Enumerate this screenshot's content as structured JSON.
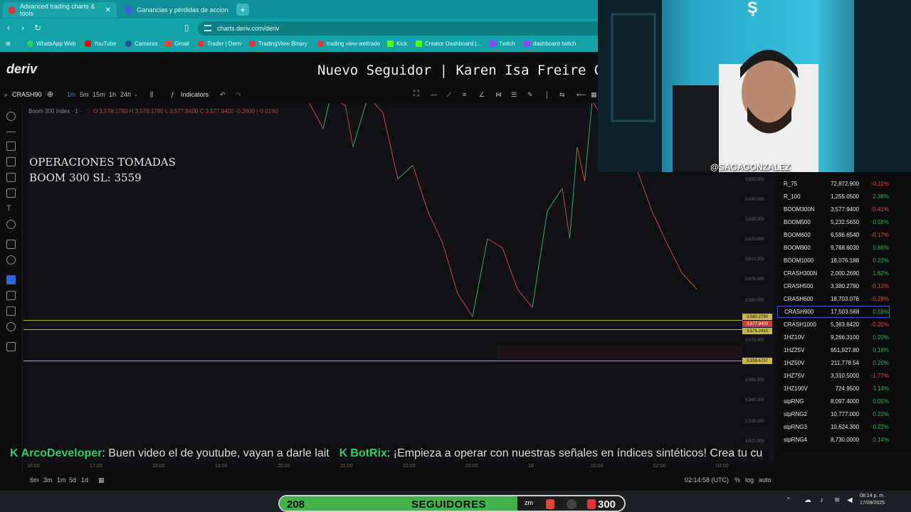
{
  "browser": {
    "tabs": [
      {
        "label": "Advanced trading charts & tools",
        "active": true
      },
      {
        "label": "Ganancias y pérdidas de acciones | Wi",
        "active": false
      }
    ],
    "url": "charts.deriv.com/deriv",
    "bookmarks": [
      "WhatsApp Web",
      "YouTube",
      "Camaras",
      "Gmail",
      "Trader | Deriv",
      "TradingView Binary",
      "trading view weltrade",
      "Kick",
      "Creator Dashboard |...",
      "Twitch",
      "dashboard twitch"
    ]
  },
  "app": {
    "logo": "deriv",
    "symbol": "CRASH90",
    "timeframes": [
      "1m",
      "5m",
      "15m",
      "1h",
      "24h"
    ],
    "indicators_label": "Indicators",
    "chart_title": "Boom 300 Index · 1 ·",
    "ohlc": "O 3,578.1780  H 3,578.1780  L 3,577.9400  C 3,577.9400  -0.2800 (-0.01%)"
  },
  "overlay": {
    "follower_banner": "Nuevo Seguidor | Karen Isa Freire Galindo",
    "ops_line1": "OPERACIONES TOMADAS",
    "ops_line2": "BOOM 300 SL: 3559",
    "handle": "@SAGAGONZALEZ"
  },
  "chart_data": {
    "type": "line",
    "title": "Boom 300 Index",
    "y_ticks": [
      "3,650,000",
      "3,640,000",
      "3,630,000",
      "3,620,000",
      "3,610,000",
      "3,600,000",
      "3,590,000",
      "3,570,000",
      "3,550,000",
      "3,540,000",
      "3,530,000",
      "3,520,000"
    ],
    "x_ticks": [
      "16:00",
      "17:00",
      "18:00",
      "19:00",
      "20:00",
      "21:00",
      "22:00",
      "23:00",
      "18",
      "01:00",
      "02:00",
      "03:00"
    ],
    "price_labels": [
      "3,580.2790",
      "3,577.9400",
      "3,575.2410",
      "3,559.6737"
    ],
    "y_range": [
      3518,
      3656
    ],
    "series": [
      {
        "points": [
          [
            0,
            3660
          ],
          [
            2,
            3648
          ],
          [
            3,
            3662
          ],
          [
            5,
            3658
          ],
          [
            6,
            3640
          ],
          [
            8,
            3662
          ],
          [
            10,
            3655
          ],
          [
            12,
            3626
          ],
          [
            14,
            3632
          ],
          [
            16,
            3612
          ],
          [
            18,
            3598
          ],
          [
            20,
            3576
          ],
          [
            22,
            3566
          ],
          [
            24,
            3600
          ],
          [
            26,
            3596
          ],
          [
            28,
            3578
          ],
          [
            30,
            3570
          ],
          [
            32,
            3612
          ],
          [
            34,
            3622
          ],
          [
            35,
            3600
          ],
          [
            36,
            3640
          ],
          [
            37,
            3625
          ],
          [
            38,
            3660
          ],
          [
            40,
            3650
          ],
          [
            42,
            3640
          ],
          [
            44,
            3630
          ],
          [
            46,
            3612
          ],
          [
            48,
            3598
          ],
          [
            50,
            3585
          ],
          [
            52,
            3578
          ]
        ]
      }
    ],
    "h_lines": [
      3580.279,
      3575.241,
      3559.6737
    ],
    "current_price": 3577.94
  },
  "market_list": [
    {
      "sym": "R_75",
      "price": "72,872.900",
      "change": "-0.11%",
      "dir": "down"
    },
    {
      "sym": "R_100",
      "price": "1,255.0500",
      "change": "2.38%",
      "dir": "up"
    },
    {
      "sym": "BOOM300N",
      "price": "3,577.9400",
      "change": "-0.41%",
      "dir": "down"
    },
    {
      "sym": "BOOM500",
      "price": "5,232.5650",
      "change": "0.58%",
      "dir": "up"
    },
    {
      "sym": "BOOM600",
      "price": "6,596.6540",
      "change": "-0.17%",
      "dir": "down"
    },
    {
      "sym": "BOOM900",
      "price": "9,768.6030",
      "change": "0.86%",
      "dir": "up"
    },
    {
      "sym": "BOOM1000",
      "price": "18,076.188",
      "change": "0.22%",
      "dir": "up"
    },
    {
      "sym": "CRASH300N",
      "price": "2,000.2690",
      "change": "1.62%",
      "dir": "up"
    },
    {
      "sym": "CRASH500",
      "price": "3,380.2780",
      "change": "-0.12%",
      "dir": "down"
    },
    {
      "sym": "CRASH600",
      "price": "18,703.076",
      "change": "-0.28%",
      "dir": "down"
    },
    {
      "sym": "CRASH900",
      "price": "17,503.568",
      "change": "0.59%",
      "dir": "up"
    },
    {
      "sym": "CRASH1000",
      "price": "5,363.6420",
      "change": "-0.20%",
      "dir": "down"
    },
    {
      "sym": "1HZ10V",
      "price": "9,266.3100",
      "change": "0.20%",
      "dir": "up"
    },
    {
      "sym": "1HZ25V",
      "price": "651,927.80",
      "change": "0.18%",
      "dir": "up"
    },
    {
      "sym": "1HZ50V",
      "price": "211,778.54",
      "change": "0.20%",
      "dir": "up"
    },
    {
      "sym": "1HZ75V",
      "price": "3,310.5000",
      "change": "-1.77%",
      "dir": "down"
    },
    {
      "sym": "1HZ100V",
      "price": "724.9500",
      "change": "3.14%",
      "dir": "up"
    },
    {
      "sym": "stpRNG",
      "price": "8,097.4000",
      "change": "0.05%",
      "dir": "up"
    },
    {
      "sym": "stpRNG2",
      "price": "10,777.000",
      "change": "0.22%",
      "dir": "up"
    },
    {
      "sym": "stpRNG3",
      "price": "10,624.300",
      "change": "0.22%",
      "dir": "up"
    },
    {
      "sym": "stpRNG4",
      "price": "8,730.0000",
      "change": "0.14%",
      "dir": "up"
    }
  ],
  "ticker": {
    "user1": "ArcoDeveloper",
    "msg1": ": Buen video el de youtube, vayan a darle lait",
    "user2": "BotRix",
    "msg2": ": ¡Empieza a operar con nuestras señales en índices sintéticos! Crea tu cu"
  },
  "bottom": {
    "periods": [
      "6m",
      "3m",
      "1m",
      "5d",
      "1d"
    ],
    "time": "02:14:58 (UTC)",
    "pct": "%",
    "log": "log",
    "auto": "auto"
  },
  "followers_goal": {
    "current": "208",
    "label": "SEGUIDORES",
    "target": "300",
    "progress": 0.69
  },
  "clock": {
    "time": "08:14 p. m.",
    "date": "17/09/2025"
  },
  "colors": {
    "deriv_red": "#e0353a",
    "up": "#2fae5a",
    "down": "#e0454a",
    "line": "#b7a84a",
    "chrome": "#12a2a8"
  }
}
